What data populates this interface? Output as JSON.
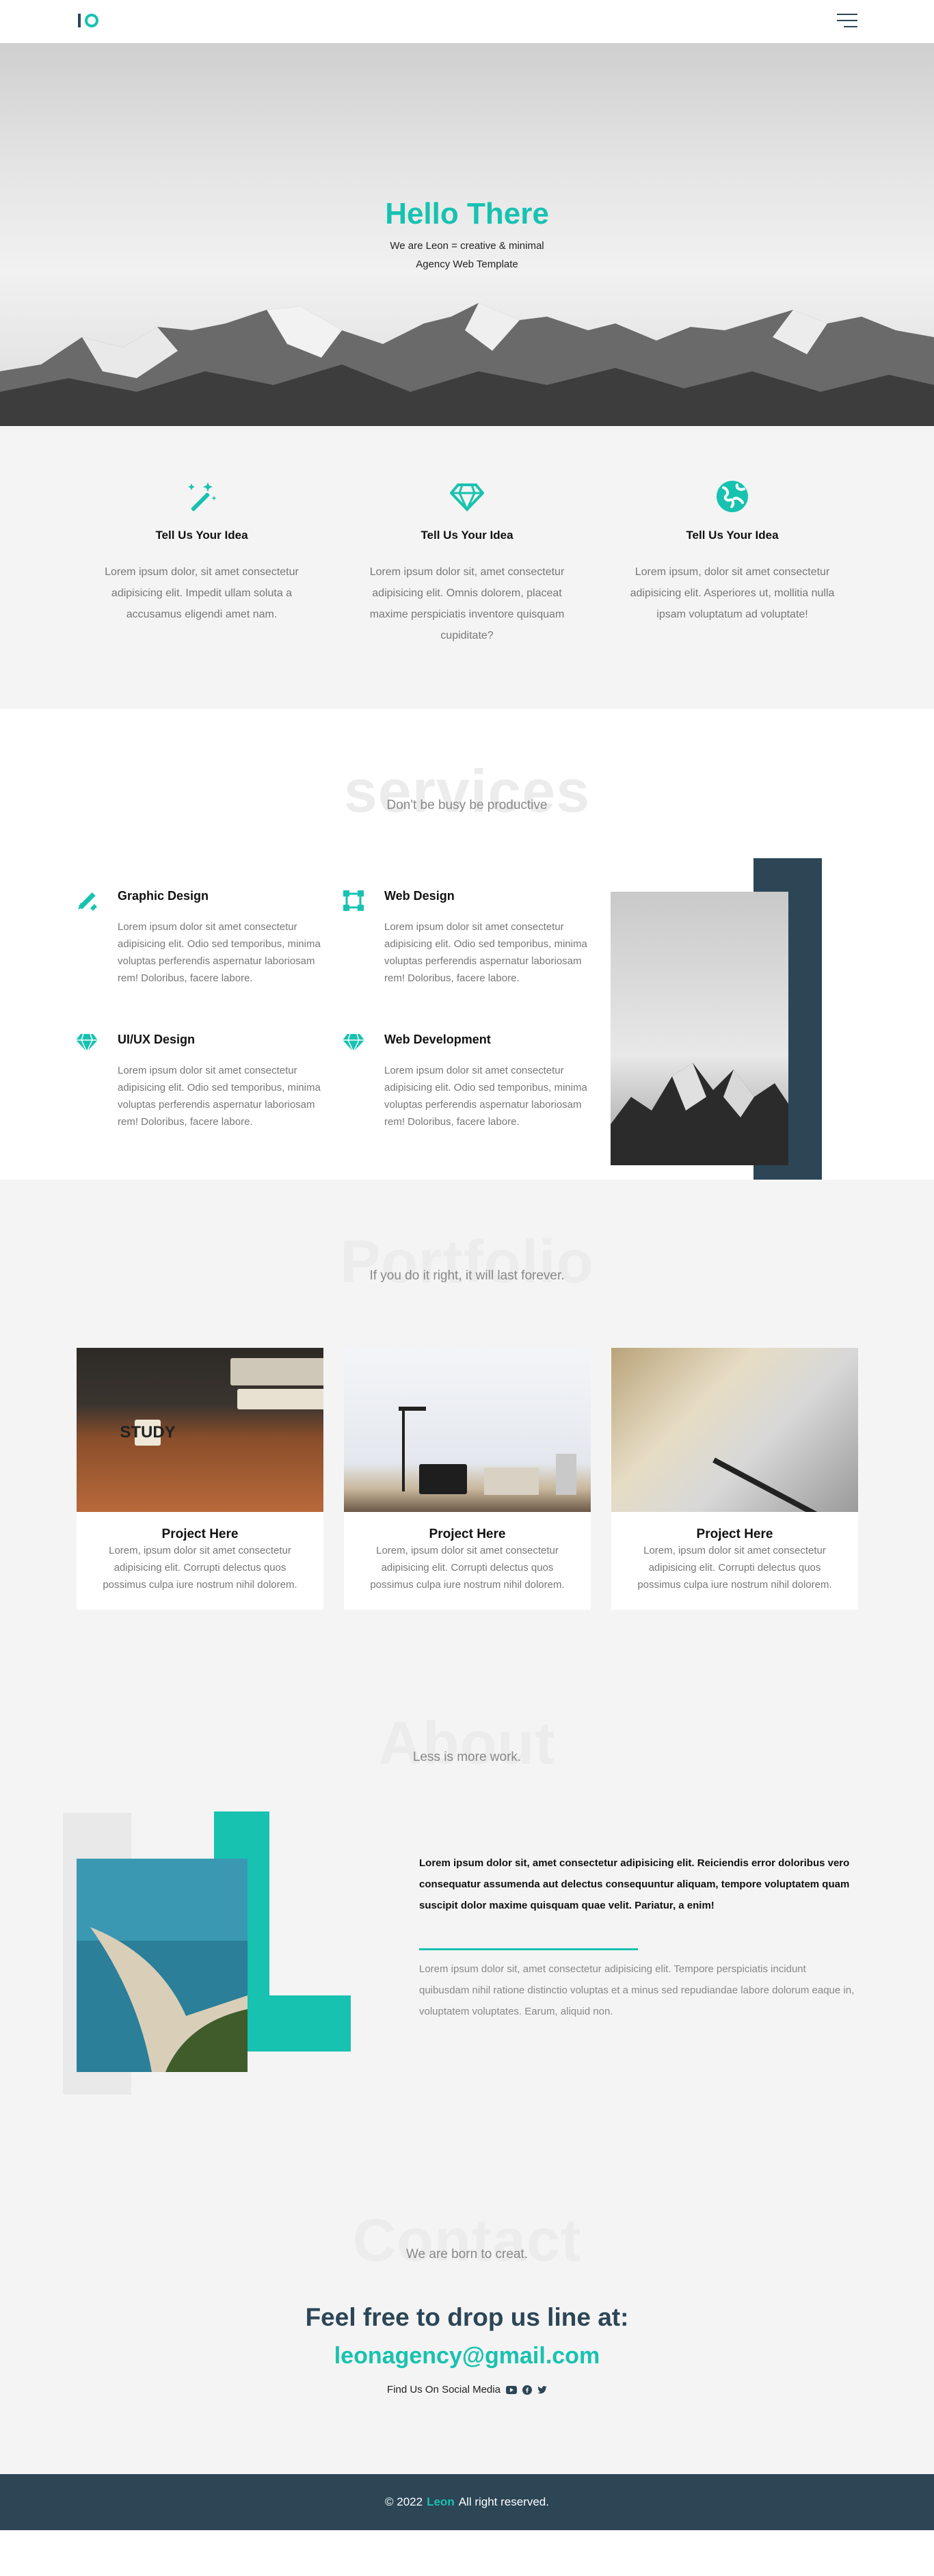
{
  "nav": {
    "menu_icon": "hamburger-menu-icon"
  },
  "hero": {
    "title": "Hello There",
    "sub_line1": "We are Leon = creative & minimal",
    "sub_line2": "Agency Web Template"
  },
  "features": [
    {
      "icon": "magic-wand-icon",
      "title": "Tell Us Your Idea",
      "text": "Lorem ipsum dolor, sit amet consectetur adipisicing elit. Impedit ullam soluta a accusamus eligendi amet nam."
    },
    {
      "icon": "diamond-icon",
      "title": "Tell Us Your Idea",
      "text": "Lorem ipsum dolor sit, amet consectetur adipisicing elit. Omnis dolorem, placeat maxime perspiciatis inventore quisquam cupiditate?"
    },
    {
      "icon": "globe-icon",
      "title": "Tell Us Your Idea",
      "text": "Lorem ipsum, dolor sit amet consectetur adipisicing elit. Asperiores ut, mollitia nulla ipsam voluptatum ad voluptate!"
    }
  ],
  "services": {
    "big_title": "services",
    "subtitle": "Don't be busy be productive",
    "items": [
      {
        "icon": "pen-ruler-icon",
        "title": "Graphic Design",
        "text": "Lorem ipsum dolor sit amet consectetur adipisicing elit. Odio sed temporibus, minima voluptas perferendis aspernatur laboriosam rem! Doloribus, facere labore."
      },
      {
        "icon": "vector-square-icon",
        "title": "Web Design",
        "text": "Lorem ipsum dolor sit amet consectetur adipisicing elit. Odio sed temporibus, minima voluptas perferendis aspernatur laboriosam rem! Doloribus, facere labore."
      },
      {
        "icon": "diamond-icon",
        "title": "UI/UX Design",
        "text": "Lorem ipsum dolor sit amet consectetur adipisicing elit. Odio sed temporibus, minima voluptas perferendis aspernatur laboriosam rem! Doloribus, facere labore."
      },
      {
        "icon": "diamond-icon",
        "title": "Web Development",
        "text": "Lorem ipsum dolor sit amet consectetur adipisicing elit. Odio sed temporibus, minima voluptas perferendis aspernatur laboriosam rem! Doloribus, facere labore."
      }
    ]
  },
  "portfolio": {
    "big_title": "Portfolio",
    "subtitle": "If you do it right, it will last forever.",
    "cards": [
      {
        "title": "Project Here",
        "text": "Lorem, ipsum dolor sit amet consectetur adipisicing elit. Corrupti delectus quos possimus culpa iure nostrum nihil dolorem.",
        "image": "study-blocks",
        "study_word": "STUDY"
      },
      {
        "title": "Project Here",
        "text": "Lorem, ipsum dolor sit amet consectetur adipisicing elit. Corrupti delectus quos possimus culpa iure nostrum nihil dolorem.",
        "image": "desk-laptop"
      },
      {
        "title": "Project Here",
        "text": "Lorem, ipsum dolor sit amet consectetur adipisicing elit. Corrupti delectus quos possimus culpa iure nostrum nihil dolorem.",
        "image": "notebook-pen"
      }
    ]
  },
  "about": {
    "big_title": "About",
    "subtitle": "Less is more work.",
    "bold_text": "Lorem ipsum dolor sit, amet consectetur adipisicing elit. Reiciendis error doloribus vero consequatur assumenda aut delectus consequuntur aliquam, tempore voluptatem quam suscipit dolor maxime quisquam quae velit. Pariatur, a enim!",
    "text": "Lorem ipsum dolor sit, amet consectetur adipisicing elit. Tempore perspiciatis incidunt quibusdam nihil ratione distinctio voluptas et a minus sed repudiandae labore dolorum eaque in, voluptatem voluptates. Earum, aliquid non."
  },
  "contact": {
    "big_title": "Contact",
    "subtitle": "We are born to creat.",
    "heading": "Feel free to drop us line at:",
    "email": "leonagency@gmail.com",
    "social_label": "Find Us On Social Media",
    "social_icons": [
      "youtube-icon",
      "facebook-icon",
      "twitter-icon"
    ]
  },
  "footer": {
    "prefix": "© 2022",
    "brand": "Leon",
    "suffix": "All right reserved."
  },
  "colors": {
    "accent": "#17c2b0",
    "dark": "#2c4656",
    "light_bg": "#f4f4f4"
  }
}
